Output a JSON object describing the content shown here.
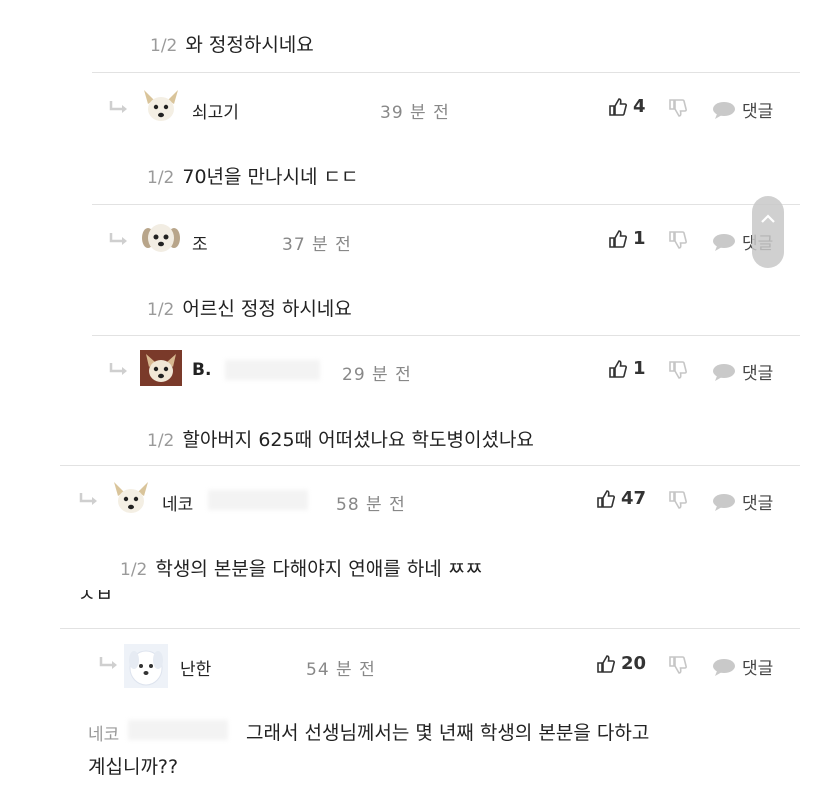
{
  "comments": [
    {
      "prefix": "1/2",
      "text": "와 정정하시네요"
    },
    {
      "name": "쇠고기",
      "time": "39 분 전",
      "likes": "4",
      "reply_label": "댓글",
      "prefix": "1/2",
      "text": "70년을 만나시네 ㄷㄷ"
    },
    {
      "name": "조",
      "time": "37 분 전",
      "likes": "1",
      "reply_label": "댓글",
      "prefix": "1/2",
      "text": "어르신 정정 하시네요"
    },
    {
      "name": "B.",
      "time": "29 분 전",
      "likes": "1",
      "reply_label": "댓글",
      "prefix": "1/2",
      "text": "할아버지 625때 어떠셨나요 학도병이셨나요"
    },
    {
      "name": "네코",
      "time": "58 분 전",
      "likes": "47",
      "reply_label": "댓글",
      "prefix": "1/2",
      "text": "학생의 본분을 다해야지 연애를 하네 ㅉㅉ",
      "overflow": "ㅅㅂ"
    },
    {
      "name": "난한",
      "time": "54 분 전",
      "likes": "20",
      "reply_label": "댓글",
      "prefix": "네코",
      "text": "그래서 선생님께서는 몇 년째 학생의 본분을 다하고",
      "text2": "계십니까??"
    }
  ]
}
